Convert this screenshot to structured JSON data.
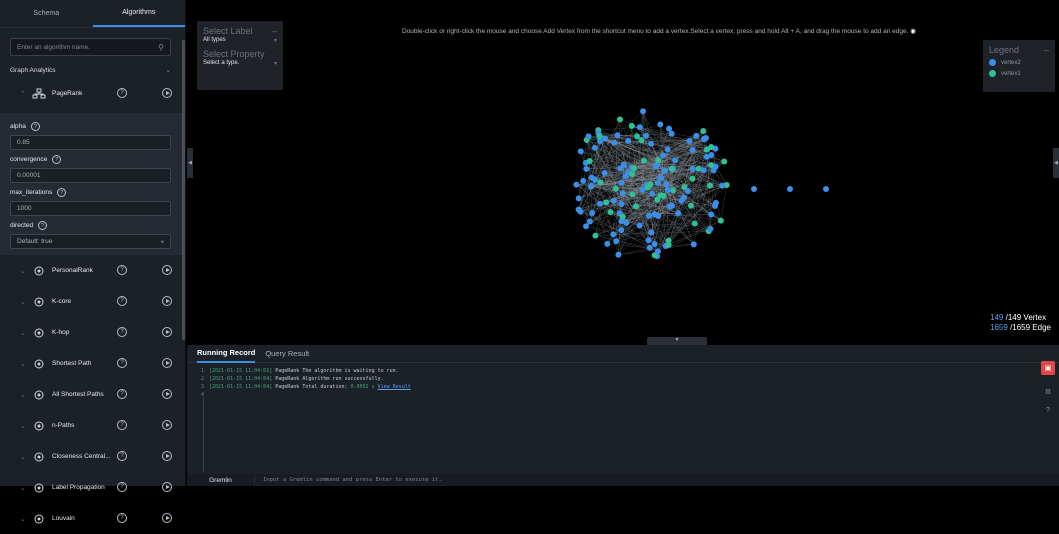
{
  "sidebar": {
    "tabs": [
      "Schema",
      "Algorithms"
    ],
    "search_placeholder": "Enter an algorithm name.",
    "category": "Graph Analytics",
    "expanded": {
      "name": "PageRank",
      "params": [
        {
          "label": "alpha",
          "value": "0.85"
        },
        {
          "label": "convergence",
          "value": "0.00001"
        },
        {
          "label": "max_iterations",
          "value": "1000"
        },
        {
          "label": "directed",
          "value": "Default: true",
          "select": true
        }
      ]
    },
    "algorithms": [
      "PersonalRank",
      "K-core",
      "K-hop",
      "Shortest Path",
      "All Shortest Paths",
      "n-Paths",
      "Closeness Central...",
      "Label Propagation",
      "Louvain"
    ]
  },
  "filter": {
    "label_title": "Select Label",
    "label_value": "All types",
    "prop_title": "Select Property",
    "prop_value": "Select a type."
  },
  "hint": "Double-click or right-click the mouse and choose Add Vertex from the shortcut menu to add a vertex.Select a vertex, press and hold Alt + A, and drag the mouse to add an edge.",
  "legend": {
    "title": "Legend",
    "items": [
      {
        "label": "vertex2",
        "color": "#3a8fe8"
      },
      {
        "label": "vertex1",
        "color": "#2fc095"
      }
    ]
  },
  "counts": {
    "vertex_shown": "149",
    "vertex_total": "/149 Vertex",
    "edge_shown": "1659",
    "edge_total": "/1659 Edge"
  },
  "bottom": {
    "tabs": [
      "Running Record",
      "Query Result"
    ],
    "logs": [
      {
        "n": "1",
        "ts": "[2021-01-15 11:04:01]",
        "text": "PageRank The algorithm is waiting to run."
      },
      {
        "n": "2",
        "ts": "[2021-01-15 11:04:04]",
        "text": "PageRank Algorithm run successfully."
      },
      {
        "n": "3",
        "ts": "[2021-01-15 11:04:04]",
        "text": "PageRank Total duration:",
        "dur": "0.0002 s",
        "link": "View Result"
      },
      {
        "n": "4",
        "ts": "",
        "text": ""
      }
    ],
    "gremlin_label": "Gremlin",
    "gremlin_placeholder": "Input a Gremlin command and press Enter to execute it."
  },
  "colors": {
    "vertex2": "#3a8fe8",
    "vertex1": "#2fc095",
    "accent": "#3a8fe8"
  }
}
